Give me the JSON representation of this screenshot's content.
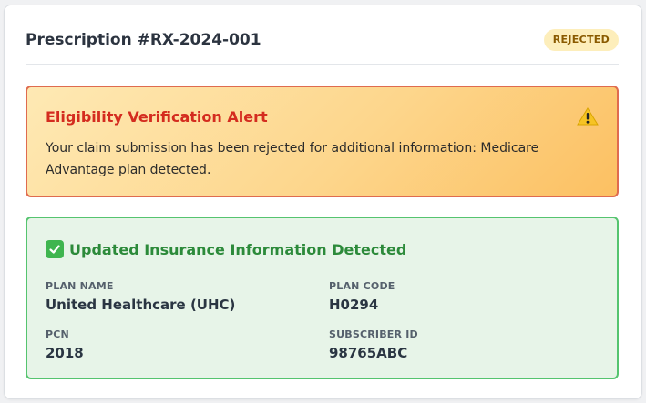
{
  "prescription": {
    "title": "Prescription #RX-2024-001",
    "status": "REJECTED"
  },
  "alert": {
    "title": "Eligibility Verification Alert",
    "icon": "warning-icon",
    "message": "Your claim submission has been rejected for additional information: Medicare Advantage plan detected."
  },
  "insurance": {
    "icon": "check-mark-icon",
    "title": "Updated Insurance Information Detected",
    "fields": [
      {
        "label": "PLAN NAME",
        "value": "United Healthcare (UHC)"
      },
      {
        "label": "PLAN CODE",
        "value": "H0294"
      },
      {
        "label": "PCN",
        "value": "2018"
      },
      {
        "label": "SUBSCRIBER ID",
        "value": "98765ABC"
      }
    ]
  },
  "colors": {
    "badge_bg": "#fdeebb",
    "alert_border": "#df6b4f",
    "alert_title": "#d42c1f",
    "success_border": "#55c46f",
    "success_title": "#2c8a3a"
  }
}
